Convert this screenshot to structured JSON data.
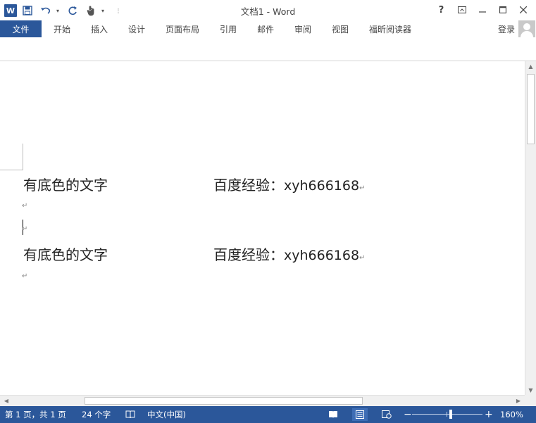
{
  "window": {
    "title": "文档1 - Word",
    "help": "?",
    "ribbon_display": "⊡",
    "minimize": "—",
    "maximize": "☐",
    "close": "✕"
  },
  "qat": {
    "logo": "W",
    "save_icon": "save-icon",
    "undo_icon": "undo-icon",
    "redo_icon": "redo-icon",
    "touch_icon": "touch-mode-icon"
  },
  "ribbon": {
    "file_tab": "文件",
    "tabs": [
      "开始",
      "插入",
      "设计",
      "页面布局",
      "引用",
      "邮件",
      "审阅",
      "视图",
      "福昕阅读器"
    ],
    "login": "登录"
  },
  "document": {
    "lines": [
      {
        "left": "有底色的文字",
        "right_cjk": "百度经验：",
        "right_latin": "xyh666168"
      },
      {
        "left": "有底色的文字",
        "right_cjk": "百度经验：",
        "right_latin": "xyh666168"
      }
    ],
    "paragraph_mark": "↵"
  },
  "statusbar": {
    "page": "第 1 页，共 1 页",
    "words": "24 个字",
    "language": "中文(中国)",
    "zoom": "160%",
    "zoom_level_percent": 160,
    "zoom_minus": "−",
    "zoom_plus": "+"
  },
  "colors": {
    "accent": "#2b579a",
    "status_bar": "#2b579a"
  }
}
